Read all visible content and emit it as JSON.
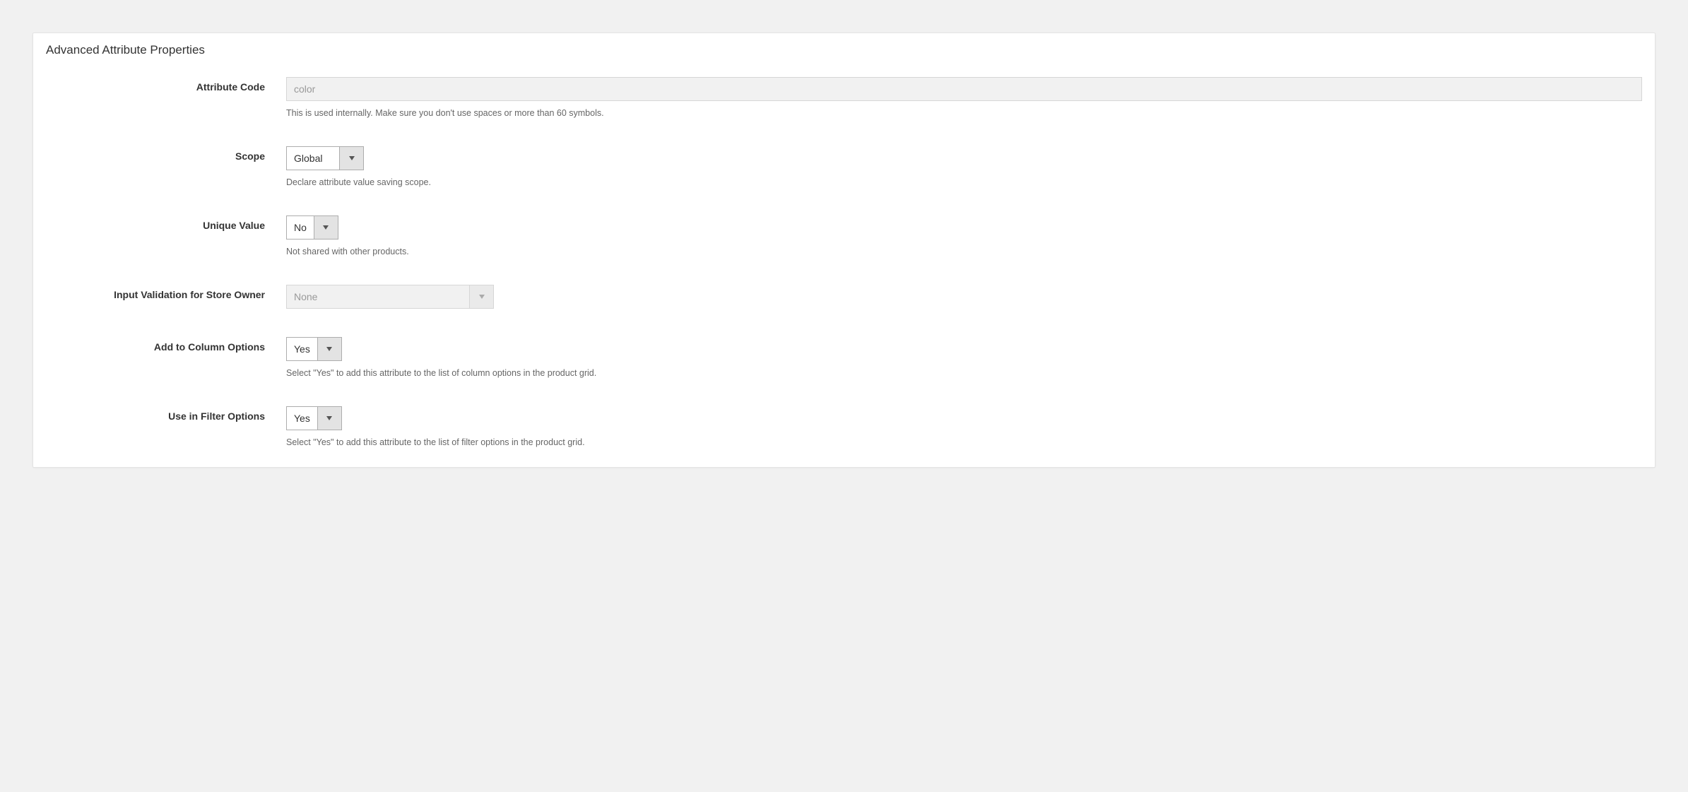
{
  "panel": {
    "title": "Advanced Attribute Properties"
  },
  "fields": {
    "attribute_code": {
      "label": "Attribute Code",
      "value": "color",
      "note": "This is used internally. Make sure you don't use spaces or more than 60 symbols."
    },
    "scope": {
      "label": "Scope",
      "value": "Global",
      "note": "Declare attribute value saving scope."
    },
    "unique_value": {
      "label": "Unique Value",
      "value": "No",
      "note": "Not shared with other products."
    },
    "input_validation": {
      "label": "Input Validation for Store Owner",
      "value": "None"
    },
    "add_to_column": {
      "label": "Add to Column Options",
      "value": "Yes",
      "note": "Select \"Yes\" to add this attribute to the list of column options in the product grid."
    },
    "use_in_filter": {
      "label": "Use in Filter Options",
      "value": "Yes",
      "note": "Select \"Yes\" to add this attribute to the list of filter options in the product grid."
    }
  }
}
